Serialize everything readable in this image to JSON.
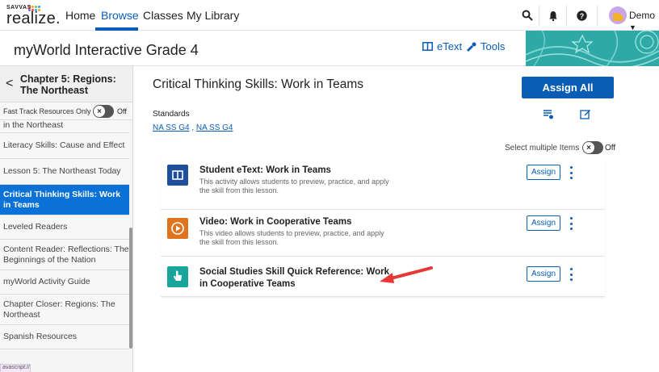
{
  "topnav": {
    "logo_small": "SAVVAS",
    "logo_text": "realize.",
    "logo_dot_colors": [
      "#e8463a",
      "#f5a623",
      "#7ac143",
      "#2fa8e0",
      "#9b59b6",
      "#e8463a",
      "#2fa8e0",
      "#f5a623"
    ],
    "links": [
      "Home",
      "Browse",
      "Classes",
      "My Library"
    ],
    "active_link": "Browse",
    "user_name": "Demo",
    "icons": [
      "search-icon",
      "bell-icon",
      "help-icon",
      "user-avatar"
    ]
  },
  "program": {
    "title": "myWorld Interactive Grade 4",
    "etext_label": "eText",
    "tools_label": "Tools"
  },
  "sidebar": {
    "chapter_title": "Chapter 5: Regions: The Northeast",
    "fast_track_label": "Fast Track Resources Only",
    "fast_track_state": "Off",
    "items": [
      {
        "label": "in the Northeast",
        "active": false
      },
      {
        "label": "Literacy Skills: Cause and Effect",
        "active": false
      },
      {
        "label": "Lesson 5: The Northeast Today",
        "active": false
      },
      {
        "label": "Critical Thinking Skills: Work in Teams",
        "active": true
      },
      {
        "label": "Leveled Readers",
        "active": false
      },
      {
        "label": "Content Reader: Reflections: The Beginnings of the Nation",
        "active": false
      },
      {
        "label": "myWorld Activity Guide",
        "active": false
      },
      {
        "label": "Chapter Closer: Regions: The Northeast",
        "active": false
      },
      {
        "label": "Spanish Resources",
        "active": false
      }
    ],
    "status_tip": "avascript://"
  },
  "main": {
    "title": "Critical Thinking Skills: Work in Teams",
    "assign_all_label": "Assign All",
    "standards_label": "Standards",
    "standards": [
      "NA SS G4",
      "NA SS G4"
    ],
    "select_multiple_label": "Select multiple Items",
    "select_multiple_state": "Off",
    "assign_label": "Assign",
    "resources": [
      {
        "title": "Student eText: Work in Teams",
        "description": "This activity allows students to preview, practice, and apply the skill from this lesson.",
        "icon": "book-icon",
        "icon_color": "#1f4e9c"
      },
      {
        "title": "Video: Work in Cooperative Teams",
        "description": "This video allows students to preview, practice, and apply the skill from this lesson.",
        "icon": "play-icon",
        "icon_color": "#e0731e"
      },
      {
        "title": "Social Studies Skill Quick Reference: Work in Cooperative Teams",
        "description": "",
        "icon": "hand-pointer-icon",
        "icon_color": "#1aa59a"
      }
    ]
  },
  "colors": {
    "primary": "#0a5db5",
    "active_sidebar": "#0a72d6",
    "annotation_arrow": "#e53935",
    "banner": "#2fa8a8"
  }
}
